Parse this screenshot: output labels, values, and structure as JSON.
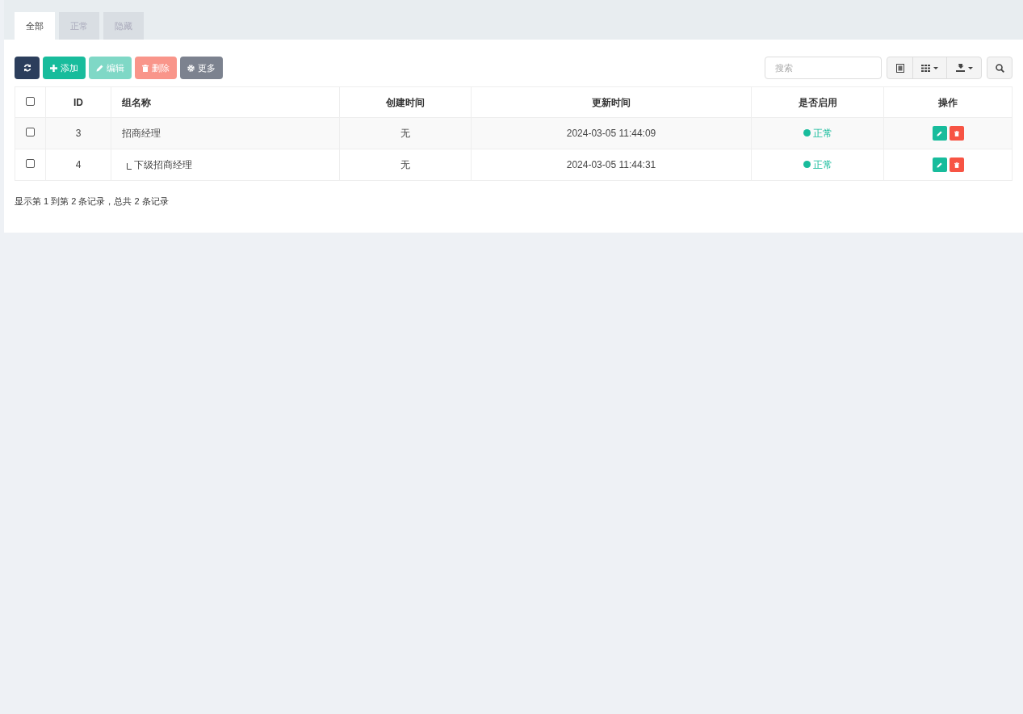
{
  "tabs": [
    {
      "label": "全部",
      "selected": true
    },
    {
      "label": "正常",
      "selected": false
    },
    {
      "label": "隐藏",
      "selected": false
    }
  ],
  "toolbar": [
    {
      "kind": "refresh",
      "disabled": false
    },
    {
      "kind": "add",
      "label": "添加",
      "disabled": false
    },
    {
      "kind": "edit",
      "label": "编辑",
      "disabled": true
    },
    {
      "kind": "delete",
      "label": "删除",
      "disabled": true
    },
    {
      "kind": "more",
      "label": "更多",
      "disabled": false
    }
  ],
  "search": {
    "placeholder": "搜索"
  },
  "table": {
    "select_all_checked": false,
    "columns": [
      "ID",
      "组名称",
      "创建时间",
      "更新时间",
      "是否启用",
      "操作"
    ],
    "rows": [
      {
        "id": "3",
        "name": "招商经理",
        "created": "无",
        "updated": "2024-03-05 11:44:09",
        "status": "正常",
        "checked": false,
        "children": [
          {
            "id": "4",
            "name": "下级招商经理",
            "created": "无",
            "updated": "2024-03-05 11:44:31",
            "status": "正常",
            "checked": false
          }
        ]
      }
    ]
  },
  "pagination_info": "显示第 1 到第 2 条记录，总共 2 条记录"
}
